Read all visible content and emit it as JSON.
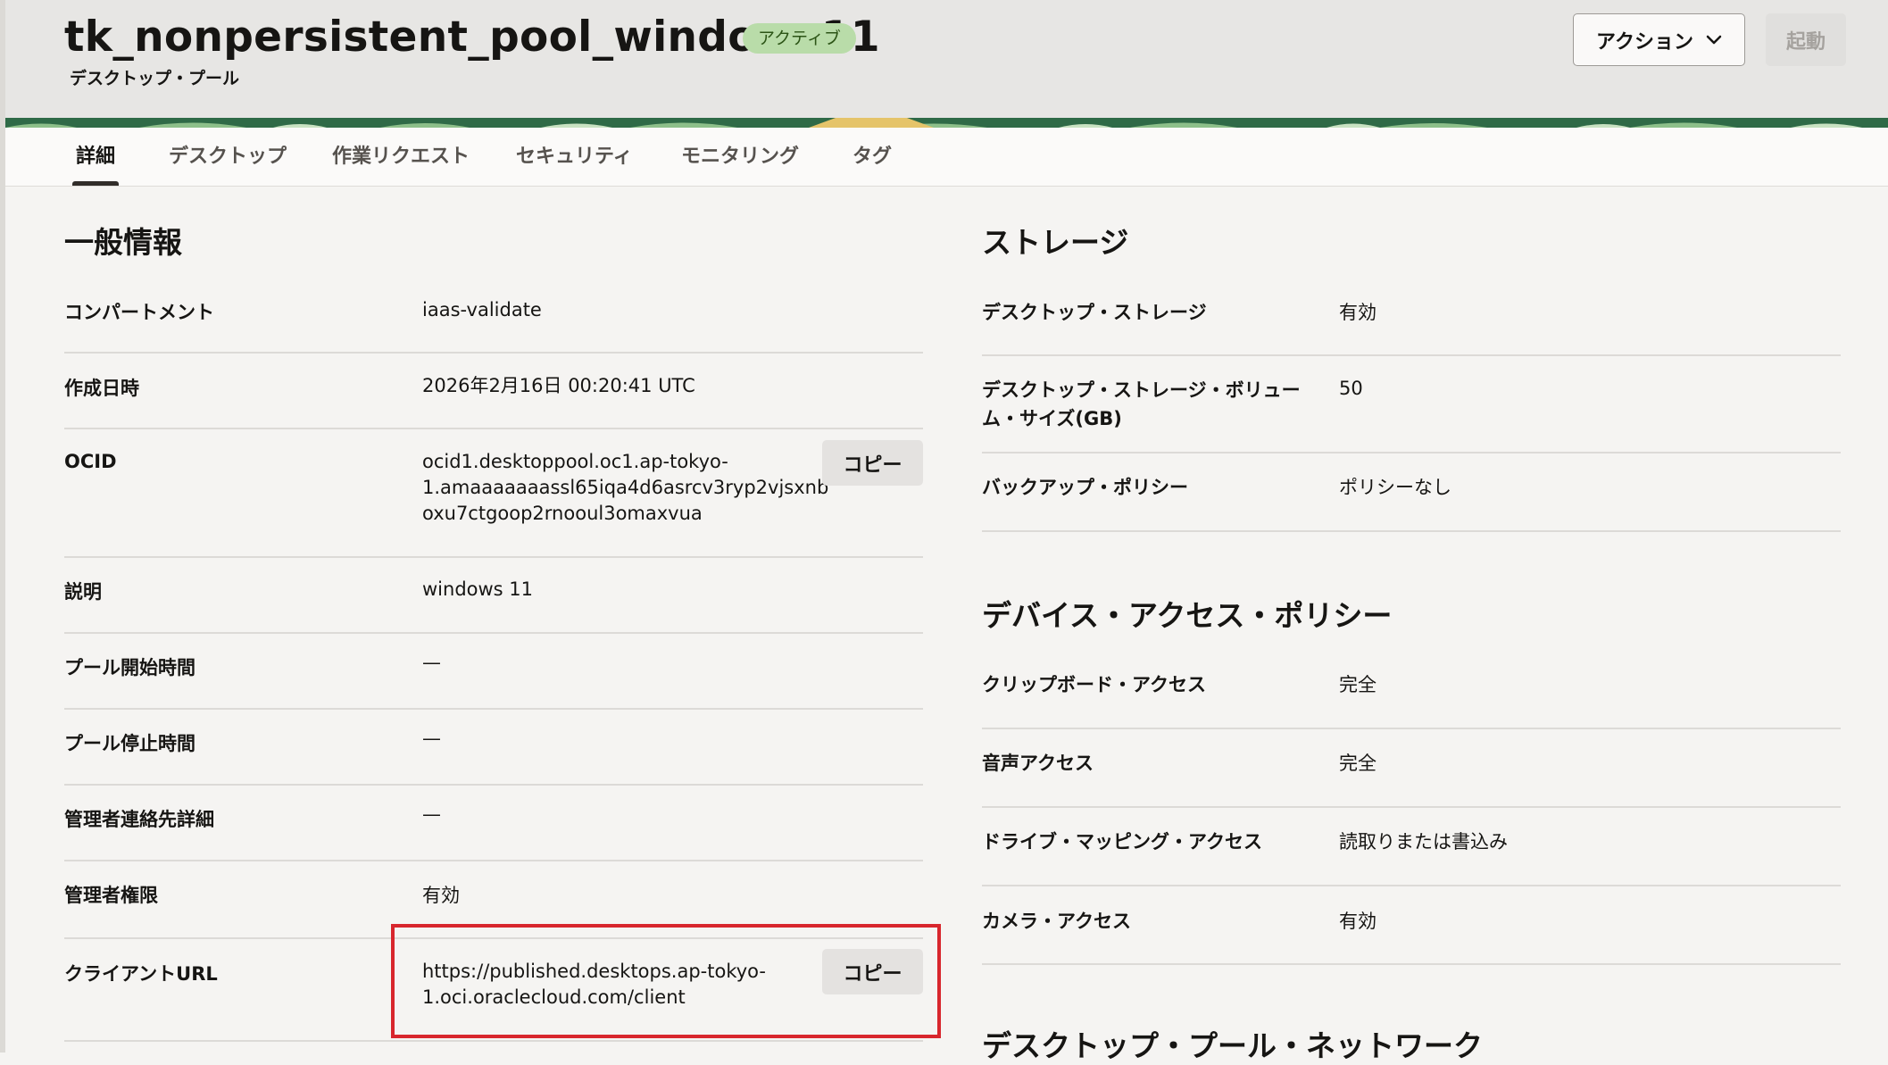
{
  "header": {
    "title": "tk_nonpersistent_pool_windows11",
    "status": "アクティブ",
    "subtitle": "デスクトップ・プール",
    "actions_label": "アクション",
    "start_label": "起動"
  },
  "tabs": [
    "詳細",
    "デスクトップ",
    "作業リクエスト",
    "セキュリティ",
    "モニタリング",
    "タグ"
  ],
  "general": {
    "title": "一般情報",
    "rows": [
      {
        "label": "コンパートメント",
        "value": "iaas-validate"
      },
      {
        "label": "作成日時",
        "value": "2026年2月16日 00:20:41 UTC"
      },
      {
        "label": "OCID",
        "value_lines": [
          "ocid1.desktoppool.oc1.ap-tokyo-",
          "1.amaaaaaaassl65iqa4d6asrcv3ryp2vjsxnb",
          "oxu7ctgoop2rnooul3omaxvua"
        ],
        "copy_label": "コピー"
      },
      {
        "label": "説明",
        "value": "windows 11"
      },
      {
        "label": "プール開始時間",
        "value": "—"
      },
      {
        "label": "プール停止時間",
        "value": "—"
      },
      {
        "label": "管理者連絡先詳細",
        "value": "—"
      },
      {
        "label": "管理者権限",
        "value": "有効"
      },
      {
        "label": "クライアントURL",
        "value_lines": [
          "https://published.desktops.ap-tokyo-",
          "1.oci.oraclecloud.com/client"
        ],
        "copy_label": "コピー"
      }
    ]
  },
  "storage": {
    "title": "ストレージ",
    "rows": [
      {
        "label": "デスクトップ・ストレージ",
        "value": "有効"
      },
      {
        "label_lines": [
          "デスクトップ・ストレージ・ボリュー",
          "ム・サイズ(GB)"
        ],
        "value": "50"
      },
      {
        "label": "バックアップ・ポリシー",
        "value": "ポリシーなし"
      }
    ]
  },
  "device_access": {
    "title": "デバイス・アクセス・ポリシー",
    "rows": [
      {
        "label": "クリップボード・アクセス",
        "value": "完全"
      },
      {
        "label": "音声アクセス",
        "value": "完全"
      },
      {
        "label": "ドライブ・マッピング・アクセス",
        "value": "読取りまたは書込み"
      },
      {
        "label": "カメラ・アクセス",
        "value": "有効"
      }
    ]
  },
  "network": {
    "title": "デスクトップ・プール・ネットワーク"
  },
  "colors": {
    "status_badge_bg": "#b9dca9",
    "highlight": "#d8262d",
    "banner": "#2f6a47"
  }
}
